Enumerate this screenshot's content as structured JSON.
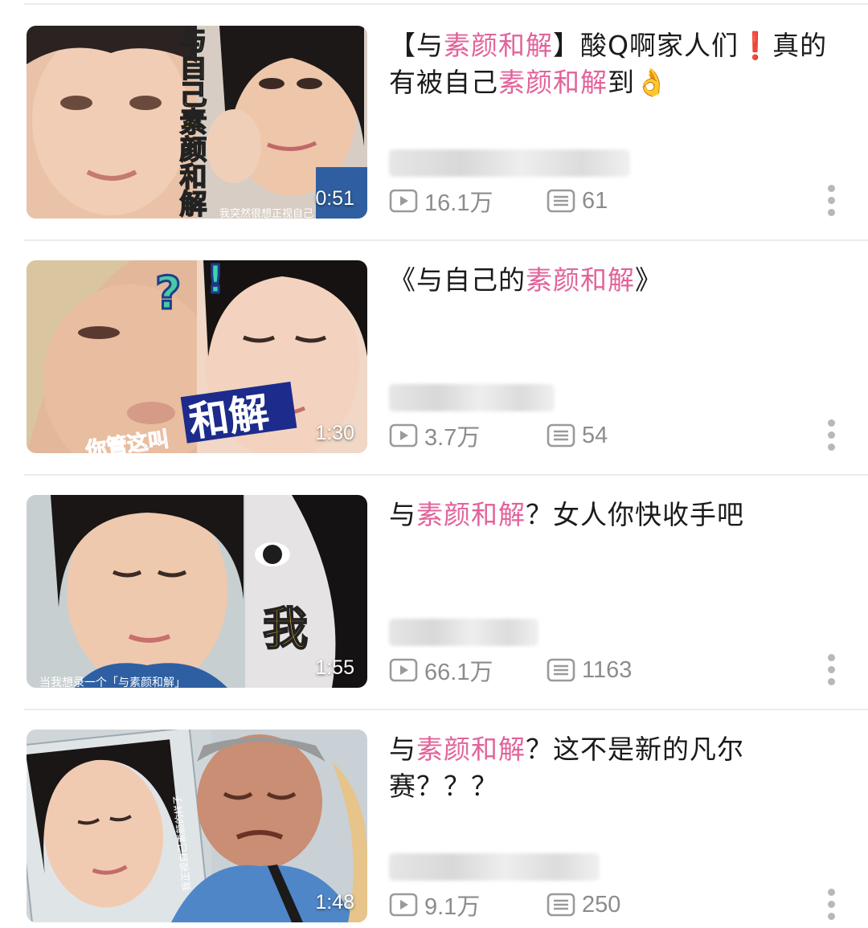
{
  "videos": [
    {
      "title_parts": [
        {
          "text": "【与",
          "style": "normal"
        },
        {
          "text": "素颜和解",
          "style": "highlight"
        },
        {
          "text": "】酸Q啊家人们",
          "style": "normal"
        },
        {
          "text": "❗",
          "style": "red"
        },
        {
          "text": "真的有被自己",
          "style": "normal"
        },
        {
          "text": "素颜和解",
          "style": "highlight"
        },
        {
          "text": "到👌",
          "style": "normal"
        }
      ],
      "duration": "0:51",
      "views": "16.1万",
      "comments": "61",
      "thumb_caption_vertical": "与自己素颜和解",
      "thumb_caption_bottom": "我突然很想正视自己"
    },
    {
      "title_parts": [
        {
          "text": "《与自己的",
          "style": "normal"
        },
        {
          "text": "素颜和解",
          "style": "highlight"
        },
        {
          "text": "》",
          "style": "normal"
        }
      ],
      "duration": "1:30",
      "views": "3.7万",
      "comments": "54",
      "thumb_caption_small": "你管这叫",
      "thumb_caption_big": "和解",
      "thumb_marks": [
        "?",
        "!"
      ]
    },
    {
      "title_parts": [
        {
          "text": "与",
          "style": "normal"
        },
        {
          "text": "素颜和解",
          "style": "highlight"
        },
        {
          "text": "？女人你快收手吧",
          "style": "normal"
        }
      ],
      "duration": "1:55",
      "views": "66.1万",
      "comments": "1163",
      "thumb_caption_big": "我",
      "thumb_caption_bottom": "当我想录一个「与素颜和解」"
    },
    {
      "title_parts": [
        {
          "text": "与",
          "style": "normal"
        },
        {
          "text": "素颜和解",
          "style": "highlight"
        },
        {
          "text": "？这不是新的凡尔赛？？？",
          "style": "normal"
        }
      ],
      "duration": "1:48",
      "views": "9.1万",
      "comments": "250",
      "thumb_caption_side": "我正视自己素颜的样子"
    }
  ],
  "colors": {
    "highlight": "#e2639b",
    "accent_red": "#e0242f",
    "meta_gray": "#8c8c8c",
    "divider": "#ececec"
  },
  "icons": {
    "views": "play-count-icon",
    "comments": "danmaku-count-icon",
    "more": "more-vertical-icon"
  }
}
